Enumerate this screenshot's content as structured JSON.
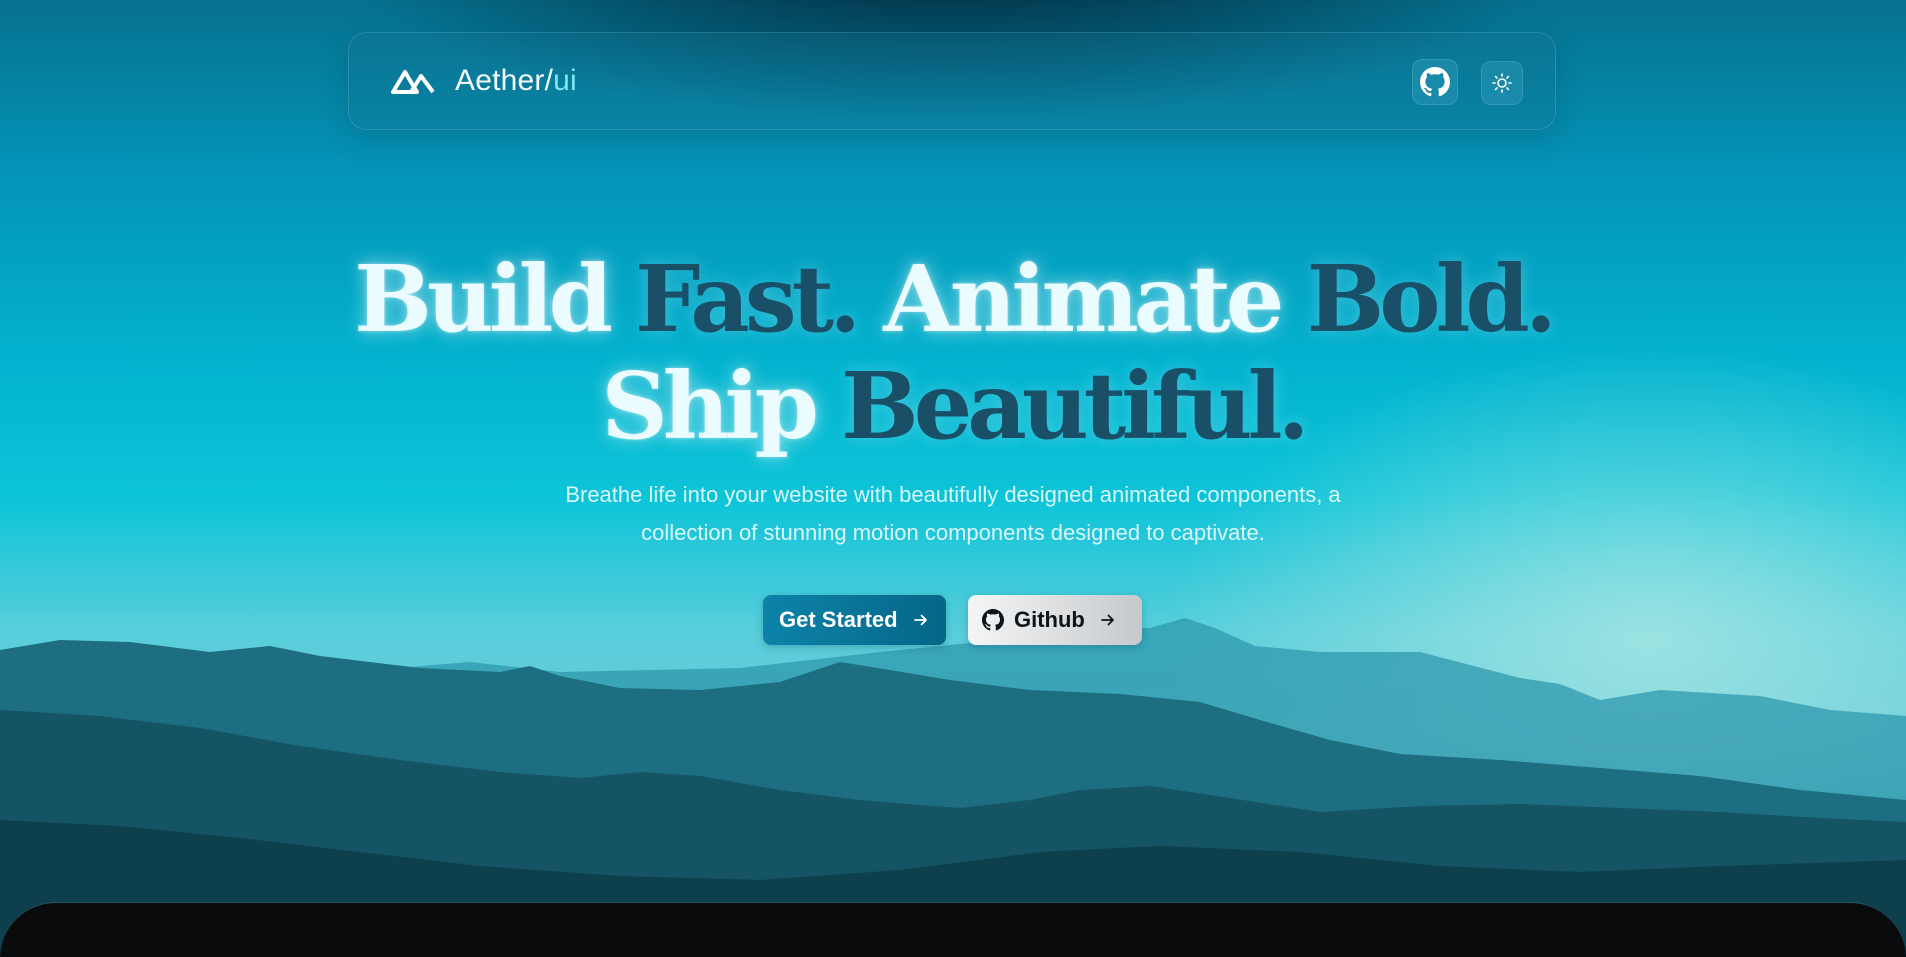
{
  "brand": {
    "name": "Aether/",
    "accent": "ui",
    "logo_icon": "aether-peaks-logo-icon"
  },
  "nav": {
    "github_icon": "github-icon",
    "theme_icon": "sun-icon"
  },
  "hero": {
    "line1": {
      "word1": "Build",
      "word2": "Fast.",
      "word3": "Animate",
      "word4": "Bold."
    },
    "line2": {
      "word1": "Ship",
      "word2": "Beautiful."
    },
    "subtitle_line1": "Breathe life into your website with beautifully designed animated components, a",
    "subtitle_line2": "collection of stunning motion components designed to captivate."
  },
  "actions": {
    "primary_label": "Get Started",
    "secondary_label": "Github"
  },
  "colors": {
    "accent": "#7ee6f5",
    "primary_button": "#0d83a9",
    "headline_light": "#eafcff",
    "headline_dark": "#1a4f68",
    "bottom_panel": "#0a0b0d"
  }
}
